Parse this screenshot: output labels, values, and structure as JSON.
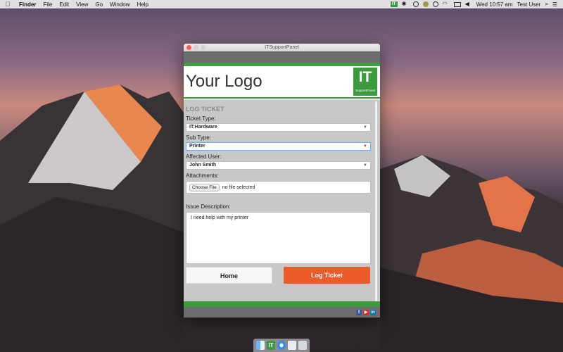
{
  "menubar": {
    "apple": "",
    "app": "Finder",
    "items": [
      "File",
      "Edit",
      "View",
      "Go",
      "Window",
      "Help"
    ],
    "status_icons": [
      "it-icon",
      "bluetooth-icon",
      "creative-cloud-icon",
      "badge-icon",
      "sync-icon",
      "wifi-icon",
      "airplay-icon",
      "volume-icon"
    ],
    "clock": "Wed 10:57 am",
    "user": "Test User"
  },
  "window": {
    "title": "ITSupportPanel",
    "logo_text": "Your Logo",
    "it_logo": {
      "big": "IT",
      "small": "SupportPanel"
    },
    "form": {
      "section_title": "LOG TICKET",
      "ticket_type_label": "Ticket Type:",
      "ticket_type_value": "IT:Hardware",
      "sub_type_label": "Sub Type:",
      "sub_type_value": "Printer",
      "affected_user_label": "Affected User:",
      "affected_user_value": "John Smith",
      "attachments_label": "Attachments:",
      "choose_file_label": "Choose File",
      "file_status": "no file selected",
      "issue_label": "Issue Description:",
      "issue_value": "I need help with my printer",
      "home_button": "Home",
      "log_button": "Log Ticket"
    },
    "social": [
      "f",
      "▶",
      "in"
    ]
  },
  "colors": {
    "accent_green": "#3f9b3f",
    "log_orange": "#ee5b2b"
  }
}
